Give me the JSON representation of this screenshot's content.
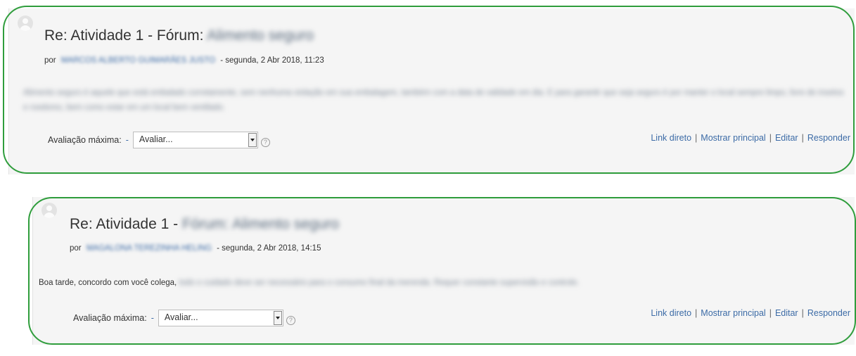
{
  "posts": [
    {
      "title_prefix": "Re: Atividade 1 - Fórum:",
      "title_rest": "Alimento seguro",
      "by_label": "por",
      "author": "MARCOS ALBERTO GUIMARÃES JUSTO",
      "date": "- segunda, 2 Abr 2018, 11:23",
      "message_visible": "",
      "message_blurred": "Alimento seguro é aquele que está embalado corretamente, sem nenhuma violação em sua embalagem, também com a data de validade em dia. E para garantir que seja seguro é por manter o local sempre limpo, livre de insetos e roedores, bem como estar em um local bem ventilado.",
      "rating_label": "Avaliação máxima:",
      "rating_value": "-",
      "select_value": "Avaliar...",
      "help_glyph": "?",
      "commands": [
        "Link direto",
        "Mostrar principal",
        "Editar",
        "Responder"
      ]
    },
    {
      "title_prefix": "Re: Atividade 1 -",
      "title_rest": "Fórum: Alimento seguro",
      "by_label": "por",
      "author": "MAGALONA TEREZINHA HELING",
      "date": "- segunda, 2 Abr 2018, 14:15",
      "message_visible": "Boa tarde, concordo com você colega,",
      "message_blurred": "todo o cuidado deve ser necessário para o consumo final da merenda. Requer constante supervisão e controle.",
      "rating_label": "Avaliação máxima:",
      "rating_value": "-",
      "select_value": "Avaliar...",
      "help_glyph": "?",
      "commands": [
        "Link direto",
        "Mostrar principal",
        "Editar",
        "Responder"
      ]
    }
  ],
  "colors": {
    "highlight": "#2f9d3c",
    "link": "#3c6ba6",
    "post_background": "#f5f5f5"
  },
  "icons": {
    "avatar": "default-user-avatar-icon",
    "help": "help-icon",
    "dropdown": "dropdown-arrow-icon"
  }
}
